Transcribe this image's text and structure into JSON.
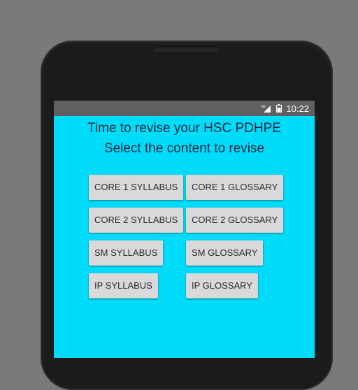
{
  "status_bar": {
    "network": "3G",
    "time": "10:22"
  },
  "content": {
    "heading_line1": "Time to revise your HSC PDHPE",
    "heading_line2": "Select the content to revise"
  },
  "buttons": [
    [
      "CORE 1 SYLLABUS",
      "CORE 1 GLOSSARY"
    ],
    [
      "CORE 2 SYLLABUS",
      "CORE 2 GLOSSARY"
    ],
    [
      "SM SYLLABUS",
      "SM GLOSSARY"
    ],
    [
      "IP SYLLABUS",
      "IP GLOSSARY"
    ]
  ],
  "colors": {
    "screen_background": "#00dbf9",
    "status_bar": "#606060",
    "button": "#d9d9d9",
    "heading_text": "#102a40"
  }
}
